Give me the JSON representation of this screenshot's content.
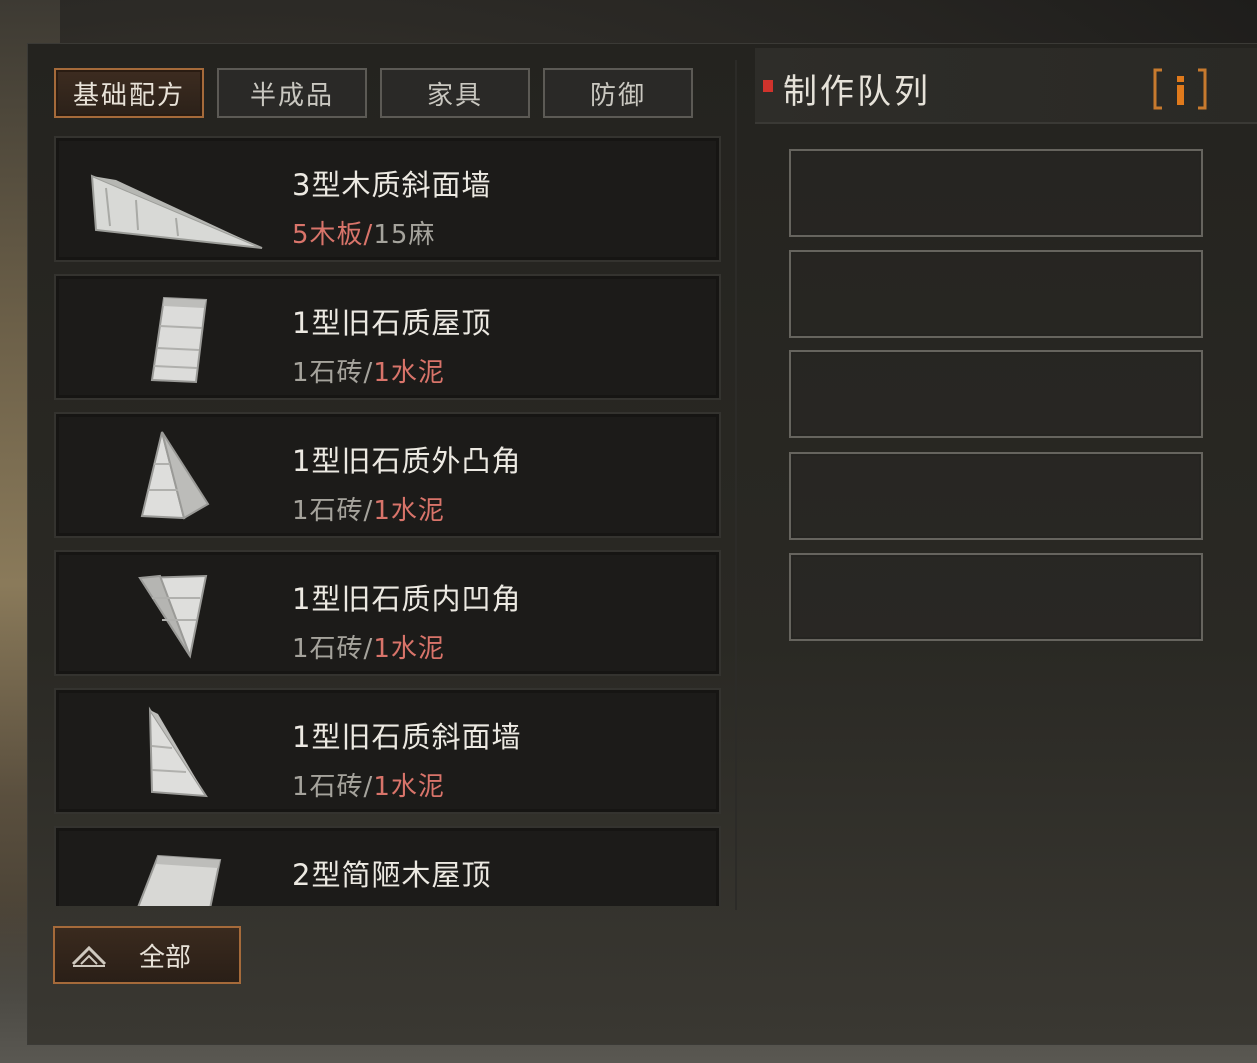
{
  "tabs": [
    {
      "label": "基础配方",
      "active": true
    },
    {
      "label": "半成品",
      "active": false
    },
    {
      "label": "家具",
      "active": false
    },
    {
      "label": "防御",
      "active": false
    }
  ],
  "recipes": [
    {
      "name": "3型木质斜面墙",
      "mat1": "5木板",
      "sep": "/",
      "mat2": "15麻",
      "mat1_missing": true,
      "mat2_missing": false,
      "icon": "wooden-slope-wall-icon"
    },
    {
      "name": "1型旧石质屋顶",
      "mat1": "1石砖",
      "sep": "/",
      "mat2": "1水泥",
      "mat1_missing": false,
      "mat2_missing": true,
      "icon": "stone-roof-icon"
    },
    {
      "name": "1型旧石质外凸角",
      "mat1": "1石砖",
      "sep": "/",
      "mat2": "1水泥",
      "mat1_missing": false,
      "mat2_missing": true,
      "icon": "stone-outer-corner-icon"
    },
    {
      "name": "1型旧石质内凹角",
      "mat1": "1石砖",
      "sep": "/",
      "mat2": "1水泥",
      "mat1_missing": false,
      "mat2_missing": true,
      "icon": "stone-inner-corner-icon"
    },
    {
      "name": "1型旧石质斜面墙",
      "mat1": "1石砖",
      "sep": "/",
      "mat2": "1水泥",
      "mat1_missing": false,
      "mat2_missing": true,
      "icon": "stone-slope-wall-icon"
    },
    {
      "name": "2型简陋木屋顶",
      "icon": "wooden-roof-icon"
    }
  ],
  "all_button": {
    "label": "全部",
    "icon": "collapse-arrow-icon"
  },
  "queue": {
    "title": "制作队列",
    "info_label": "i",
    "slots": 5
  },
  "colors": {
    "accent": "#a56a3a",
    "missing": "#d9746a",
    "marker": "#d0332c",
    "info": "#e07a1c"
  }
}
